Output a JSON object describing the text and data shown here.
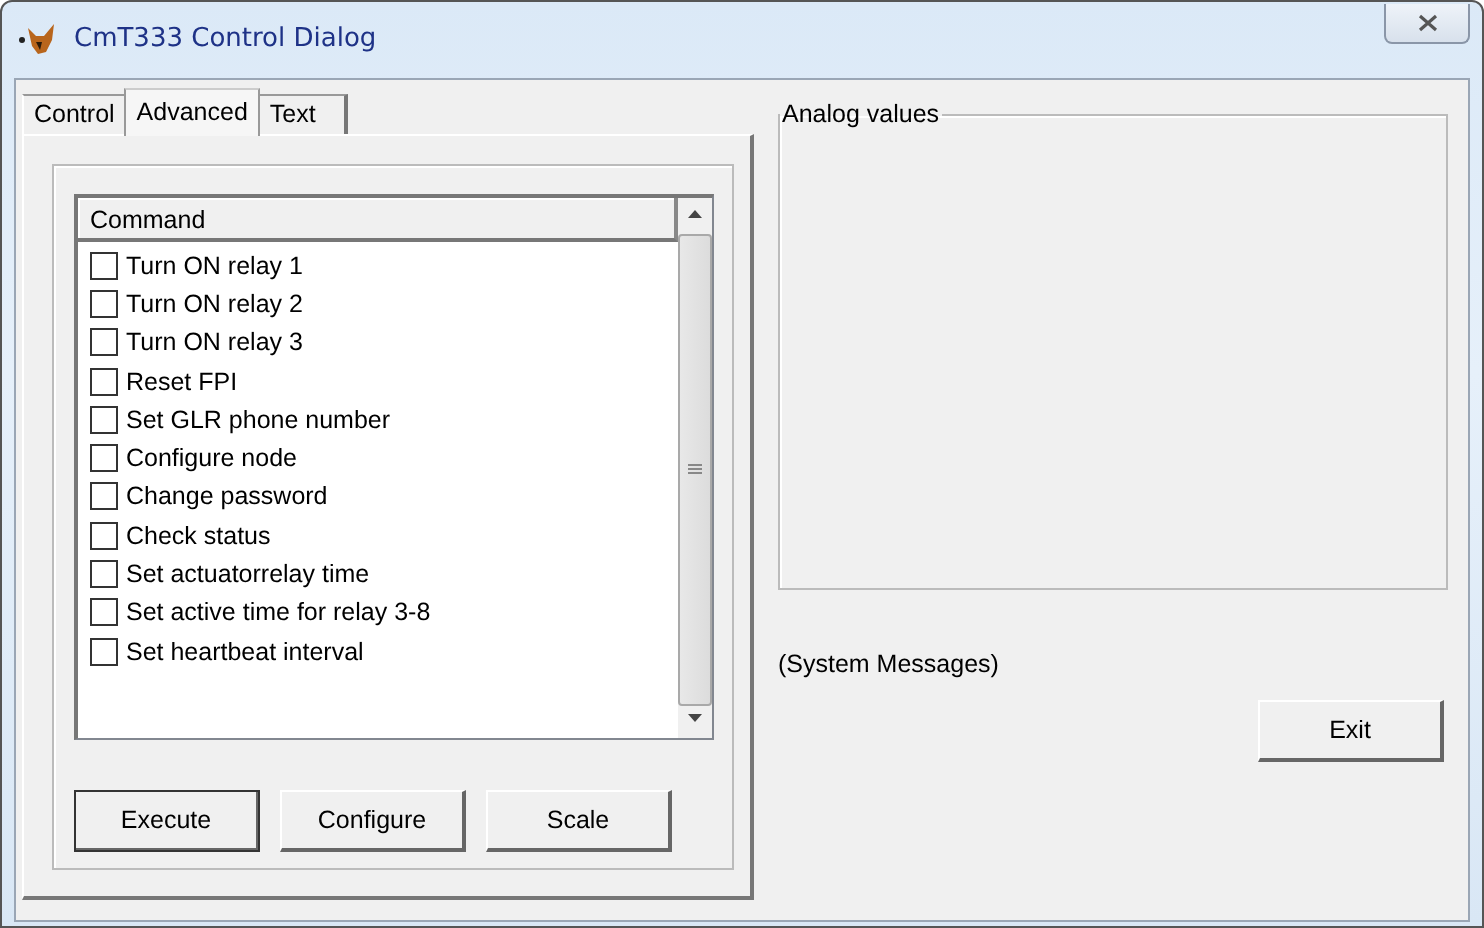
{
  "window": {
    "title": "CmT333 Control Dialog"
  },
  "tabs": [
    {
      "label": "Control",
      "selected": false
    },
    {
      "label": "Advanced",
      "selected": true
    },
    {
      "label": "Text",
      "selected": false
    }
  ],
  "command_list": {
    "column": "Command",
    "items": [
      {
        "label": "Turn ON relay 1",
        "checked": false
      },
      {
        "label": "Turn ON relay 2",
        "checked": false
      },
      {
        "label": "Turn ON relay 3",
        "checked": false
      },
      {
        "label": "Reset FPI",
        "checked": false
      },
      {
        "label": "Set GLR phone number",
        "checked": false
      },
      {
        "label": "Configure node",
        "checked": false
      },
      {
        "label": "Change password",
        "checked": false
      },
      {
        "label": "Check status",
        "checked": false
      },
      {
        "label": "Set actuatorrelay time",
        "checked": false
      },
      {
        "label": "Set active time for relay 3-8",
        "checked": false
      },
      {
        "label": "Set heartbeat interval",
        "checked": false
      }
    ]
  },
  "buttons": [
    {
      "label": "Execute",
      "default": true
    },
    {
      "label": "Configure",
      "default": false
    },
    {
      "label": "Scale",
      "default": false
    }
  ],
  "analog_group": {
    "title": "Analog values"
  },
  "system_messages": "(System Messages)",
  "exit_button": {
    "label": "Exit"
  }
}
